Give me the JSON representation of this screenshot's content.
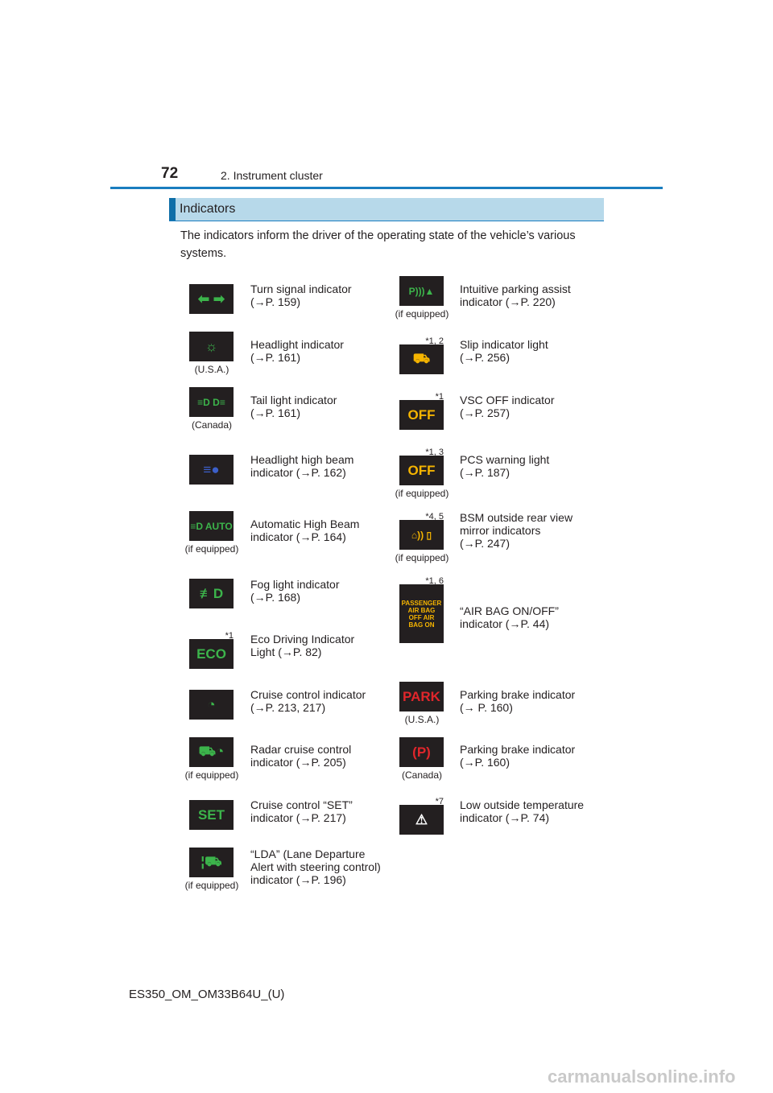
{
  "header": {
    "page_number": "72",
    "chapter": "2. Instrument cluster"
  },
  "section": {
    "title": "Indicators",
    "intro": "The indicators inform the driver of the operating state of the vehicle’s various systems."
  },
  "colors": {
    "accent": "#1a7dbf",
    "section_bg": "#b7d9ea",
    "icon_bg": "#231f20",
    "green": "#3cb44b",
    "amber": "#f5b400",
    "blue": "#3c5fc8",
    "red": "#e0262b"
  },
  "left_indicators": [
    {
      "icon": "turn-signal-icon",
      "glyph": "⬅ ➡",
      "color": "green",
      "text": [
        "Turn signal indicator",
        "(→P. 159)"
      ]
    },
    {
      "icon": "headlight-icon",
      "glyph": "☼",
      "color": "green",
      "note": "(U.S.A.)",
      "text": [
        "Headlight indicator",
        "(→P. 161)"
      ]
    },
    {
      "icon": "tail-light-icon",
      "glyph": "≡D D≡",
      "color": "green",
      "note": "(Canada)",
      "text": [
        "Tail light indicator",
        "(→P. 161)"
      ]
    },
    {
      "icon": "high-beam-icon",
      "glyph": "≡●",
      "color": "blue",
      "text": [
        "Headlight high beam",
        "indicator (→P. 162)"
      ]
    },
    {
      "icon": "auto-high-beam-icon",
      "glyph": "≡D AUTO",
      "color": "green",
      "note": "(if equipped)",
      "text": [
        "Automatic High Beam",
        "indicator (→P. 164)"
      ]
    },
    {
      "icon": "fog-light-icon",
      "glyph": "≢D",
      "color": "green",
      "text": [
        "Fog light indicator",
        "(→P. 168)"
      ]
    },
    {
      "icon": "eco-icon",
      "glyph": "ECO",
      "color": "green",
      "star": "*1",
      "text": [
        "Eco Driving Indicator",
        "Light (→P. 82)"
      ]
    },
    {
      "icon": "cruise-control-icon",
      "glyph": "◔",
      "color": "green",
      "text": [
        "Cruise control indicator",
        "(→P. 213, 217)"
      ]
    },
    {
      "icon": "radar-cruise-icon",
      "glyph": "⛟◔",
      "color": "green",
      "note": "(if equipped)",
      "text": [
        "Radar cruise control",
        "indicator (→P. 205)"
      ]
    },
    {
      "icon": "set-icon",
      "glyph": "SET",
      "color": "green",
      "text": [
        "Cruise control “SET”",
        "indicator (→P. 217)"
      ]
    },
    {
      "icon": "lda-icon",
      "glyph": "¦⛟",
      "color": "green",
      "note": "(if equipped)",
      "text": [
        "“LDA” (Lane Departure",
        "Alert with steering control)",
        "indicator (→P. 196)"
      ]
    }
  ],
  "right_indicators": [
    {
      "icon": "parking-assist-icon",
      "glyph": "P)))▲",
      "color": "green",
      "note": "(if equipped)",
      "text": [
        "Intuitive parking assist",
        "indicator (→P. 220)"
      ]
    },
    {
      "icon": "slip-icon",
      "glyph": "⛟",
      "color": "amber",
      "star": "*1, 2",
      "text": [
        "Slip indicator light",
        "(→P. 256)"
      ]
    },
    {
      "icon": "vsc-off-icon",
      "glyph": "OFF",
      "color": "amber",
      "star": "*1",
      "text": [
        "VSC OFF indicator",
        "(→P. 257)"
      ]
    },
    {
      "icon": "pcs-icon",
      "glyph": "OFF",
      "color": "amber",
      "star": "*1, 3",
      "note": "(if equipped)",
      "text": [
        "PCS warning light",
        "(→P. 187)"
      ]
    },
    {
      "icon": "bsm-icon",
      "glyph": "⌂)) ▯",
      "color": "amber",
      "star": "*4, 5",
      "note": "(if equipped)",
      "text": [
        "BSM outside rear view",
        "mirror indicators",
        "(→P. 247)"
      ]
    },
    {
      "icon": "airbag-icon",
      "glyph": "PASSENGER AIR BAG OFF AIR BAG ON",
      "color": "amber",
      "star": "*1, 6",
      "text": [
        "“AIR BAG ON/OFF”",
        "indicator (→P. 44)"
      ]
    },
    {
      "icon": "park-icon",
      "glyph": "PARK",
      "color": "red",
      "note": "(U.S.A.)",
      "text": [
        "Parking brake indicator",
        "(→ P. 160)"
      ]
    },
    {
      "icon": "parking-brake-icon",
      "glyph": "(P)",
      "color": "red",
      "note": "(Canada)",
      "text": [
        "Parking brake indicator",
        "(→P. 160)"
      ]
    },
    {
      "icon": "low-temperature-icon",
      "glyph": "⚠",
      "color": "white",
      "star": "*7",
      "text": [
        "Low outside temperature",
        "indicator (→P. 74)"
      ]
    }
  ],
  "footer": {
    "code": "ES350_OM_OM33B64U_(U)"
  },
  "watermark": "carmanualsonline.info"
}
